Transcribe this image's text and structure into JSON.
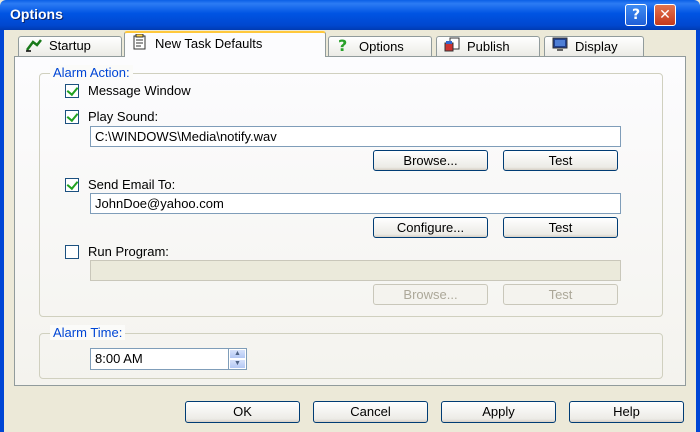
{
  "window": {
    "title": "Options",
    "help_glyph": "?",
    "close_glyph": "✕"
  },
  "tabs": [
    {
      "label": "Startup",
      "icon": "startup-icon",
      "active": false
    },
    {
      "label": "New Task Defaults",
      "icon": "notepad-icon",
      "active": true
    },
    {
      "label": "Options",
      "icon": "question-icon",
      "active": false
    },
    {
      "label": "Publish",
      "icon": "publish-icon",
      "active": false
    },
    {
      "label": "Display",
      "icon": "monitor-icon",
      "active": false
    }
  ],
  "alarm_action": {
    "legend": "Alarm Action:",
    "message_window": {
      "label": "Message Window",
      "checked": true
    },
    "play_sound": {
      "label": "Play Sound:",
      "checked": true,
      "value": "C:\\WINDOWS\\Media\\notify.wav",
      "browse_label": "Browse...",
      "test_label": "Test"
    },
    "send_email": {
      "label": "Send Email To:",
      "checked": true,
      "value": "JohnDoe@yahoo.com",
      "configure_label": "Configure...",
      "test_label": "Test"
    },
    "run_program": {
      "label": "Run Program:",
      "checked": false,
      "value": "",
      "browse_label": "Browse...",
      "test_label": "Test"
    }
  },
  "alarm_time": {
    "legend": "Alarm Time:",
    "value": "8:00 AM"
  },
  "footer": {
    "ok_label": "OK",
    "cancel_label": "Cancel",
    "apply_label": "Apply",
    "help_label": "Help"
  },
  "colors": {
    "titlebar": "#0054e3",
    "group_legend": "#0046d5",
    "check_mark": "#21a121",
    "active_tab_highlight": "#ffc83c"
  }
}
